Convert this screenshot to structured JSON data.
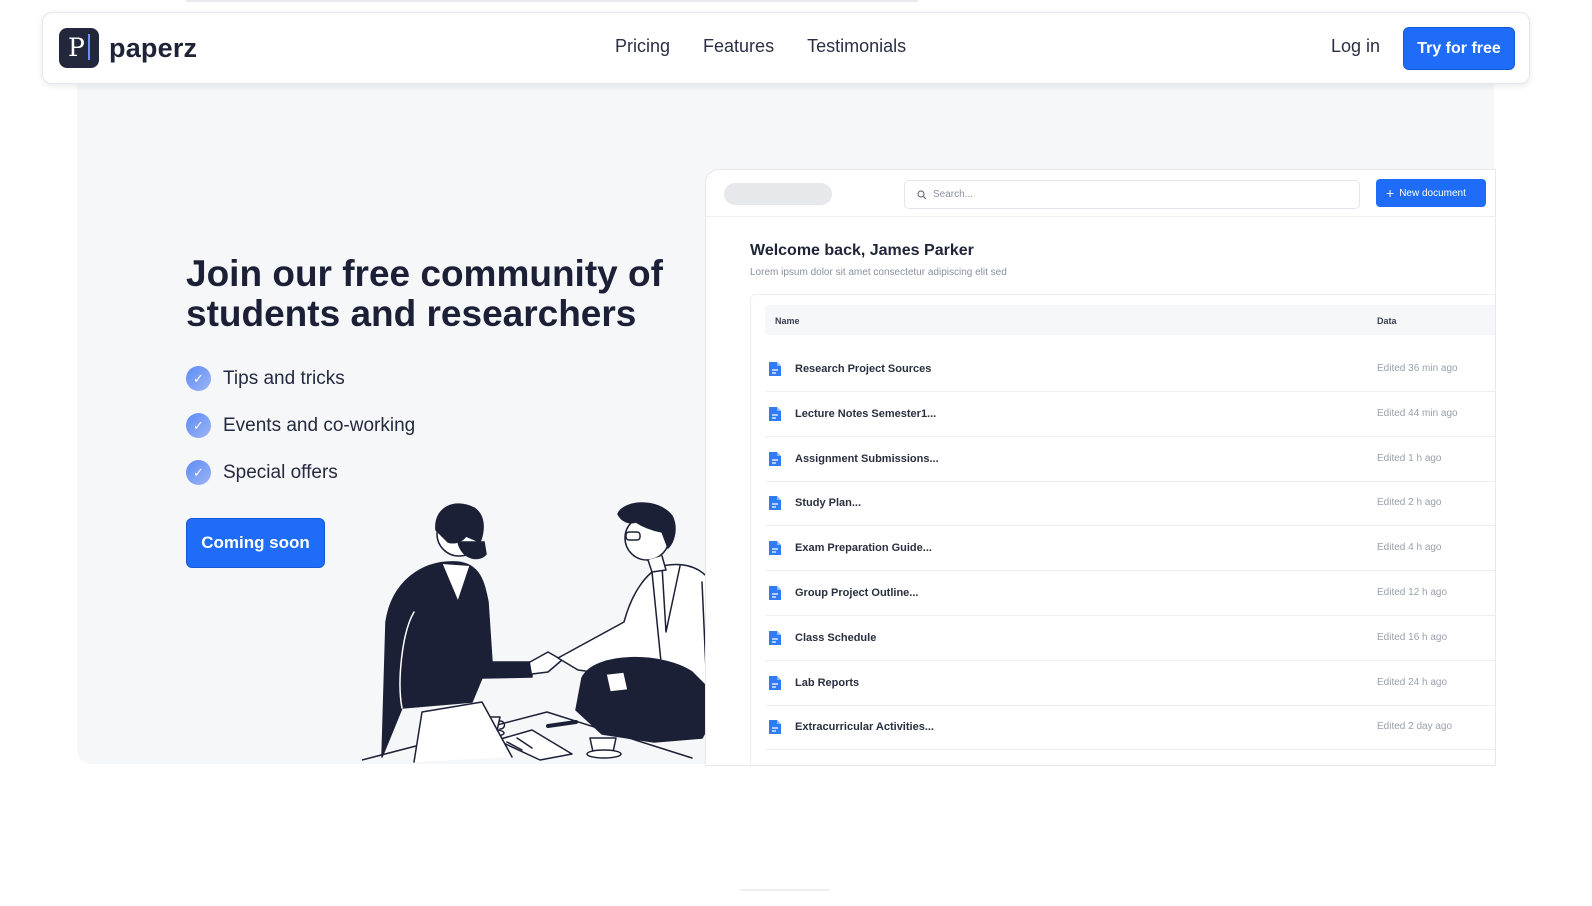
{
  "navbar": {
    "brand": "paperz",
    "logo_letter": "P",
    "links": [
      "Pricing",
      "Features",
      "Testimonials"
    ],
    "login": "Log in",
    "cta": "Try for free"
  },
  "hero": {
    "title": "Join our free community of students and researchers",
    "features": [
      "Tips and tricks",
      "Events and co-working",
      "Special offers"
    ],
    "button": "Coming soon"
  },
  "app": {
    "search_placeholder": "Search...",
    "new_document": "New document",
    "welcome": "Welcome back, James Parker",
    "subtitle": "Lorem ipsum dolor sit amet consectetur adipiscing elit sed",
    "columns": [
      "Name",
      "Data"
    ],
    "rows": [
      {
        "name": "Research Project Sources",
        "date": "Edited 36 min ago"
      },
      {
        "name": "Lecture Notes Semester1...",
        "date": "Edited 44 min ago"
      },
      {
        "name": "Assignment Submissions...",
        "date": "Edited 1 h ago"
      },
      {
        "name": "Study Plan...",
        "date": "Edited 2 h ago"
      },
      {
        "name": "Exam Preparation Guide...",
        "date": "Edited 4 h ago"
      },
      {
        "name": "Group Project Outline...",
        "date": "Edited 12 h ago"
      },
      {
        "name": "Class Schedule",
        "date": "Edited 16 h ago"
      },
      {
        "name": "Lab Reports",
        "date": "Edited 24 h ago"
      },
      {
        "name": "Extracurricular Activities...",
        "date": "Edited 2 day ago"
      }
    ]
  },
  "colors": {
    "accent": "#1e6cf7",
    "dark": "#1b2036",
    "hero_bg": "#f6f7f9"
  }
}
